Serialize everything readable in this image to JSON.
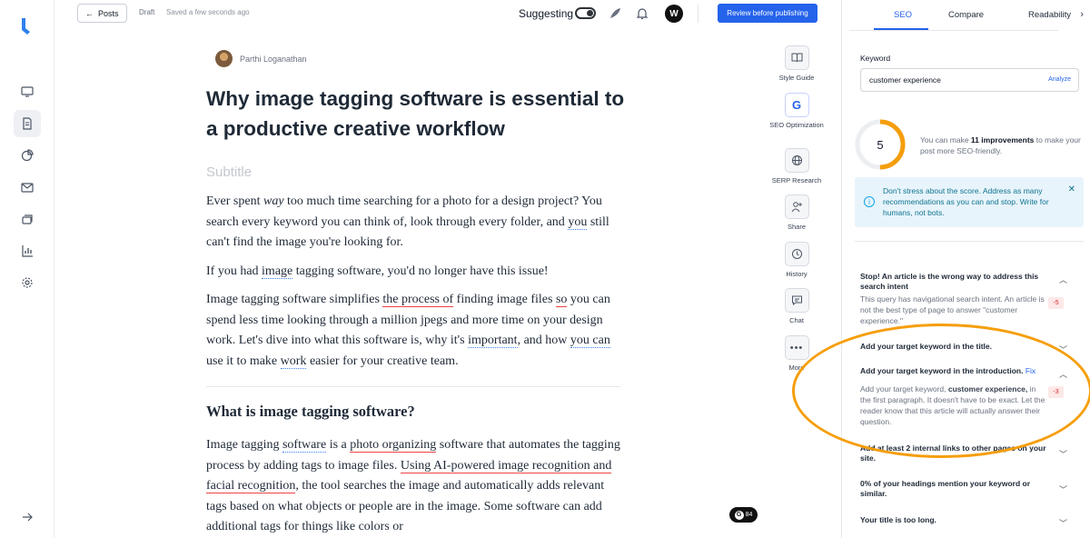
{
  "colors": {
    "accent": "#2563eb",
    "score": "#f59e0b",
    "info_bg": "#e8f4fb",
    "penalty": "#dc2626"
  },
  "sidebar": {
    "items": [
      {
        "icon": "monitor-icon"
      },
      {
        "icon": "document-icon"
      },
      {
        "icon": "pie-chart-icon"
      },
      {
        "icon": "mail-icon"
      },
      {
        "icon": "layers-icon"
      },
      {
        "icon": "bar-chart-icon"
      },
      {
        "icon": "gear-icon"
      }
    ],
    "collapse_icon": "arrow-right-icon"
  },
  "topbar": {
    "back_label": "Posts",
    "status": "Draft",
    "saved": "Saved a few seconds ago",
    "suggesting_label": "Suggesting",
    "review_label": "Review before publishing"
  },
  "editor": {
    "author": "Parthi Loganathan",
    "title": "Why image tagging software is essential to a productive creative workflow",
    "subtitle_placeholder": "Subtitle",
    "section_heading": "What is image tagging software?"
  },
  "tools": [
    {
      "label": "Style Guide",
      "icon": "book-icon"
    },
    {
      "label": "SEO Optimization",
      "icon": "google-icon"
    },
    {
      "label": "SERP Research",
      "icon": "globe-icon"
    },
    {
      "label": "Share",
      "icon": "add-user-icon"
    },
    {
      "label": "History",
      "icon": "history-icon"
    },
    {
      "label": "Chat",
      "icon": "chat-icon"
    },
    {
      "label": "More",
      "icon": "more-icon"
    }
  ],
  "grammarly": {
    "count": "84"
  },
  "panel": {
    "tabs": [
      "SEO",
      "Compare",
      "Readability"
    ],
    "keyword_label": "Keyword",
    "keyword_value": "customer experience",
    "analyze_label": "Analyze",
    "score": "5",
    "score_fraction": 0.5,
    "score_text_before": "You can make ",
    "score_text_bold": "11 improvements",
    "score_text_after": " to make your post more SEO-friendly.",
    "info_text": "Don't stress about the score. Address as many recommendations as you can and stop. Write for humans, not bots.",
    "recommendations": [
      {
        "title": "Stop! An article is the wrong way to address this search intent",
        "body": "This query has navigational search intent. An article is not the best type of page to answer \"customer experience.\"",
        "penalty": "-5"
      },
      {
        "title": "Add your target keyword in the title."
      },
      {
        "title": "Add your target keyword in the introduction.",
        "fix": "Fix",
        "body_before": "Add your target keyword, ",
        "body_bold": "customer experience,",
        "body_after": " in the first paragraph. It doesn't have to be exact. Let the reader know that this article will actually answer their question.",
        "penalty": "-3"
      },
      {
        "title": "Add at least 2 internal links to other pages on your site."
      },
      {
        "title": "0% of your headings mention your keyword or similar."
      },
      {
        "title": "Your title is too long."
      }
    ]
  }
}
